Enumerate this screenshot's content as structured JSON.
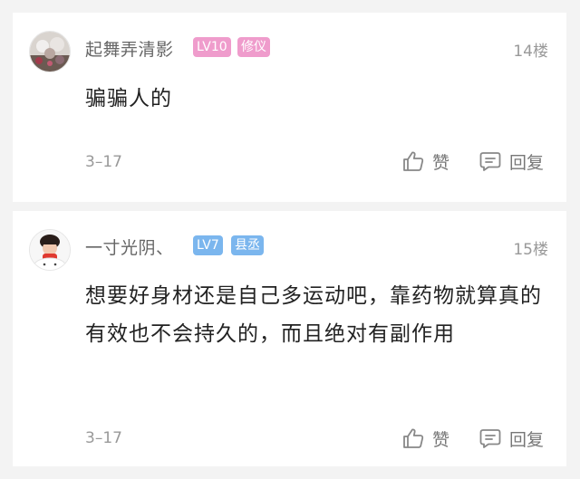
{
  "comments": [
    {
      "username": "起舞弄清影",
      "level_badge": "LV10",
      "title_badge": "修仪",
      "floor": "14楼",
      "content": "骗骗人的",
      "date": "3–17",
      "like_label": "赞",
      "reply_label": "回复",
      "level_badge_color": "#ef9ccc",
      "title_badge_color": "#ef9ccc"
    },
    {
      "username": "一寸光阴、",
      "level_badge": "LV7",
      "title_badge": "县丞",
      "floor": "15楼",
      "content": "想要好身材还是自己多运动吧，靠药物就算真的有效也不会持久的，而且绝对有副作用",
      "date": "3–17",
      "like_label": "赞",
      "reply_label": "回复",
      "level_badge_color": "#7bb6ee",
      "title_badge_color": "#7bb6ee"
    }
  ],
  "icons": {
    "like": "thumbs-up-icon",
    "reply": "comment-icon"
  },
  "colors": {
    "background": "#f3f3f3",
    "card": "#ffffff",
    "text_primary": "#222222",
    "text_secondary": "#999999"
  }
}
